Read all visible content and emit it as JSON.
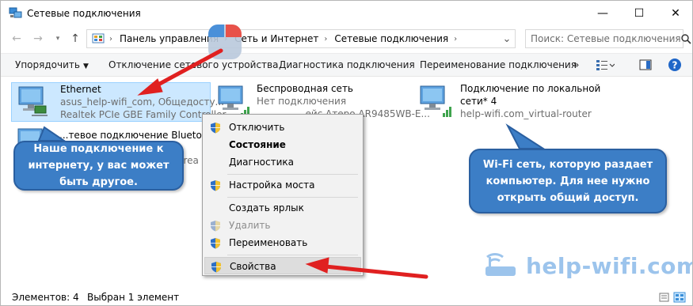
{
  "window": {
    "title": "Сетевые подключения",
    "min_glyph": "—",
    "max_glyph": "☐",
    "close_glyph": "✕"
  },
  "address": {
    "crumbs": [
      "Панель управления",
      "Сеть и Интернет",
      "Сетевые подключения"
    ],
    "search_placeholder": "Поиск: Сетевые подключения"
  },
  "commands": {
    "organize": "Упорядочить",
    "disable": "Отключение сетевого устройства",
    "diagnose": "Диагностика подключения",
    "rename": "Переименование подключения",
    "more": "»"
  },
  "connections": [
    {
      "name": "Ethernet",
      "status": "asus_help-wifi_com, Общедосту...",
      "device": "Realtek PCIe GBE Family Controller",
      "selected": true
    },
    {
      "name": "Беспроводная сеть",
      "status": "Нет подключения",
      "device": "...ейс Атеро AR9485WB-E...",
      "selected": false
    },
    {
      "name": "Подключение по локальной",
      "name2": "сети* 4",
      "status": "help-wifi.com_virtual-router",
      "selected": false
    },
    {
      "name": "...тевое подключение Bluetooth",
      "status": "...",
      "device": "...rea ...",
      "selected": false
    }
  ],
  "context_menu": {
    "items": [
      {
        "label": "Отключить",
        "shield": true,
        "bold": false,
        "disabled": false
      },
      {
        "label": "Состояние",
        "shield": false,
        "bold": true,
        "disabled": false
      },
      {
        "label": "Диагностика",
        "shield": false,
        "bold": false,
        "disabled": false
      },
      {
        "label": "Настройка моста",
        "shield": true,
        "bold": false,
        "disabled": false
      },
      {
        "label": "Создать ярлык",
        "shield": false,
        "bold": false,
        "disabled": false
      },
      {
        "label": "Удалить",
        "shield": true,
        "bold": false,
        "disabled": true
      },
      {
        "label": "Переименовать",
        "shield": true,
        "bold": false,
        "disabled": false
      },
      {
        "label": "Свойства",
        "shield": true,
        "bold": false,
        "disabled": false,
        "highlighted": true
      }
    ]
  },
  "callouts": {
    "left": "Наше подключение к интернету, у вас может быть другое.",
    "right": "Wi-Fi сеть, которую раздает компьютер. Для нее нужно открыть общий доступ."
  },
  "watermark": "help-wifi.com",
  "status": {
    "count": "Элементов: 4",
    "selected": "Выбран 1 элемент"
  },
  "colors": {
    "selection": "#cce8ff",
    "callout": "#3c7ec6",
    "arrow": "#e02020",
    "watermark": "#9cc4ec"
  }
}
